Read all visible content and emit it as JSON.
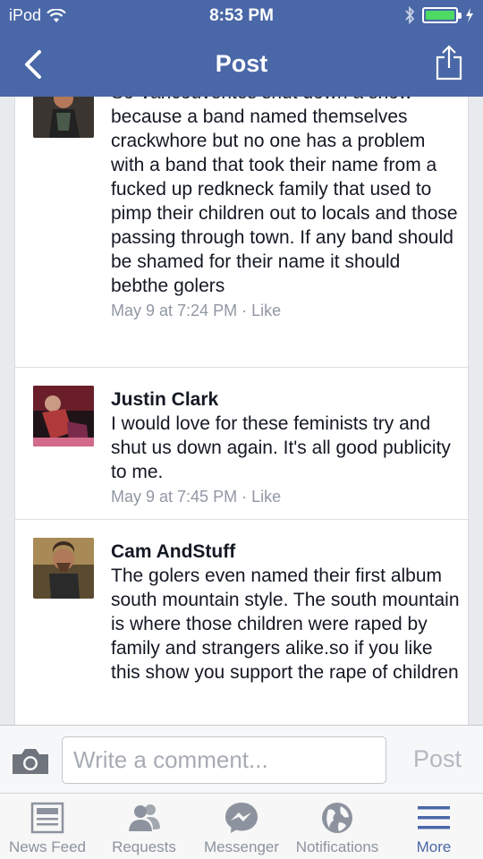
{
  "status_bar": {
    "carrier": "iPod",
    "time": "8:53 PM"
  },
  "nav": {
    "title": "Post"
  },
  "comments": [
    {
      "name": "",
      "text": "So Vancouverites shut down a show because a band named themselves crackwhore but no one has a problem with a band that took their name from a fucked up redkneck family that used to pimp their children out to locals and those passing through town. If any band should be shamed for their name it should bebthe golers",
      "time": "May 9 at 7:24 PM",
      "like_label": "Like"
    },
    {
      "name": "Justin Clark",
      "text": "I would love for these feminists try and shut us down again. It's all good publicity to me.",
      "time": "May 9 at 7:45 PM",
      "like_label": "Like"
    },
    {
      "name": "Cam AndStuff",
      "text": "The golers even named their first album south mountain style. The south mountain is where those children were raped by family and strangers alike.so if you like this show you support the rape of children",
      "time": "",
      "like_label": ""
    }
  ],
  "comment_bar": {
    "placeholder": "Write a comment...",
    "post_label": "Post"
  },
  "tabs": [
    {
      "label": "News Feed",
      "icon": "news-feed-icon",
      "active": false
    },
    {
      "label": "Requests",
      "icon": "requests-icon",
      "active": false
    },
    {
      "label": "Messenger",
      "icon": "messenger-icon",
      "active": false
    },
    {
      "label": "Notifications",
      "icon": "notifications-icon",
      "active": false
    },
    {
      "label": "More",
      "icon": "more-icon",
      "active": true
    }
  ],
  "colors": {
    "brand": "#4a67a7",
    "battery": "#4cd964",
    "meta_text": "#9197a3"
  }
}
